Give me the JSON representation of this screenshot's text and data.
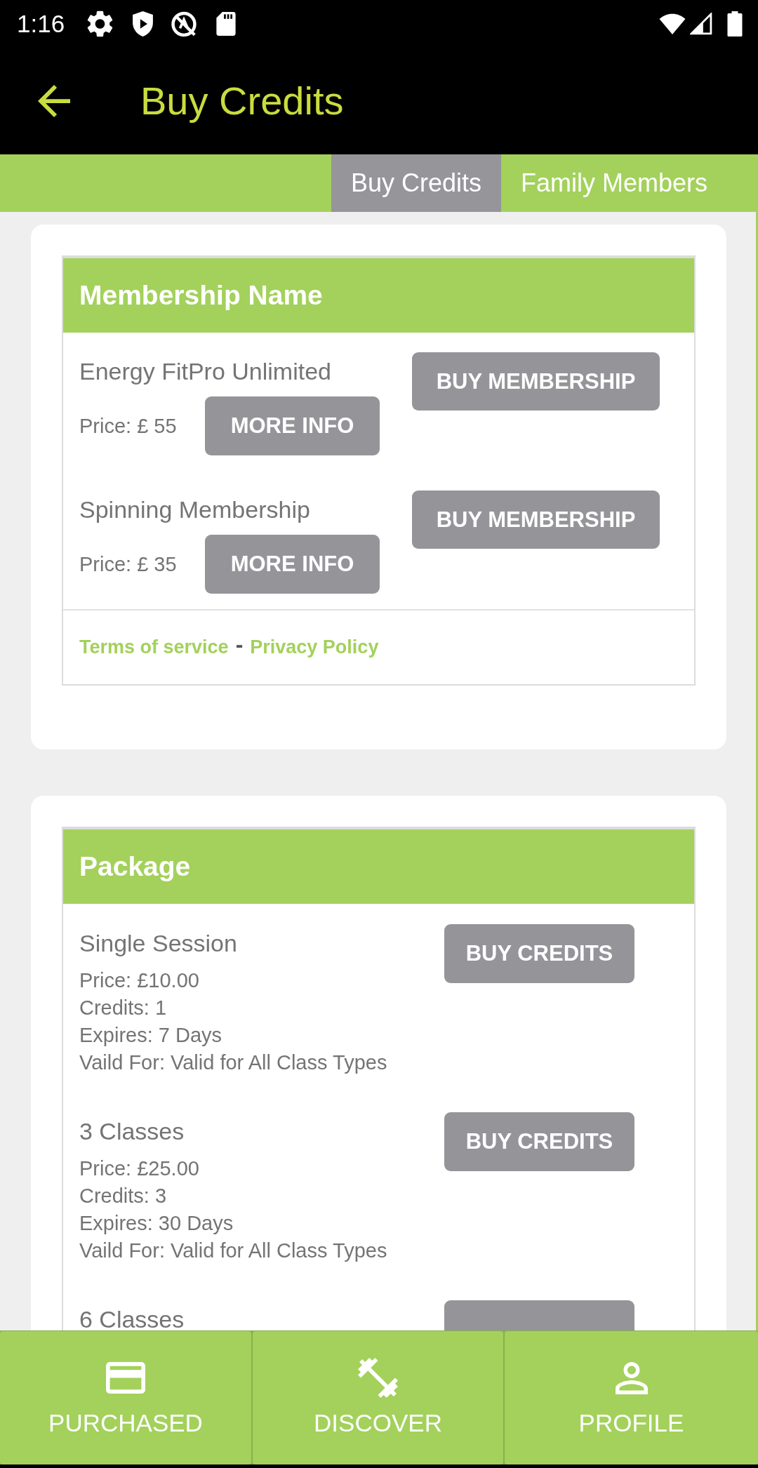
{
  "status_bar": {
    "time": "1:16"
  },
  "app_bar": {
    "title": "Buy Credits"
  },
  "tabs": [
    {
      "label": "Buy Credits",
      "selected": true
    },
    {
      "label": "Family Members",
      "selected": false
    }
  ],
  "memberships": {
    "heading": "Membership Name",
    "items": [
      {
        "name": "Energy FitPro Unlimited",
        "price": "Price: £ 55",
        "info_button": "MORE INFO",
        "buy_button": "BUY MEMBERSHIP"
      },
      {
        "name": "Spinning Membership",
        "price": "Price: £ 35",
        "info_button": "MORE INFO",
        "buy_button": "BUY MEMBERSHIP"
      }
    ],
    "links": [
      "Terms of service",
      "Privacy Policy"
    ],
    "link_separator": "-"
  },
  "packages": {
    "heading": "Package",
    "items": [
      {
        "name": "Single Session",
        "details": [
          "Price: £10.00",
          "Credits: 1",
          "Expires: 7 Days",
          "Vaild For: Valid for All Class Types"
        ],
        "buy_button": "BUY CREDITS"
      },
      {
        "name": "3 Classes",
        "details": [
          "Price: £25.00",
          "Credits: 3",
          "Expires: 30 Days",
          "Vaild For: Valid for All Class Types"
        ],
        "buy_button": "BUY CREDITS"
      },
      {
        "name": "6 Classes"
      }
    ]
  },
  "bottom_nav": [
    {
      "label": "PURCHASED"
    },
    {
      "label": "DISCOVER"
    },
    {
      "label": "PROFILE"
    }
  ]
}
